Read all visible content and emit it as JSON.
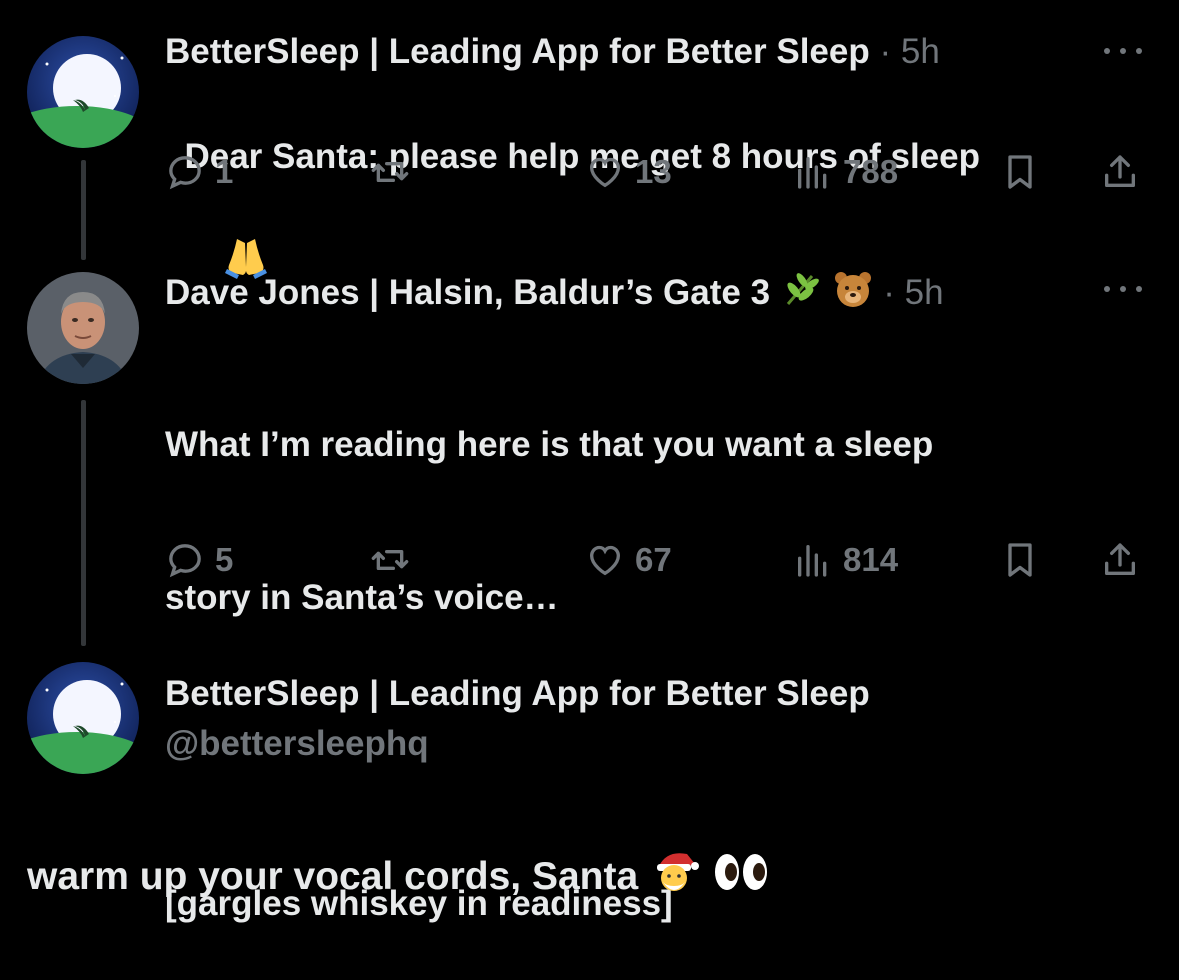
{
  "thread": {
    "tweets": [
      {
        "display_name": "BetterSleep | Leading App for Better Sleep",
        "separator": "·",
        "time": "5h",
        "text": "Dear Santa: please help me get 8 hours of sleep",
        "replies": "1",
        "likes": "13",
        "views": "788"
      },
      {
        "display_name": "Dave Jones | Halsin, Baldur’s Gate 3",
        "separator": "·",
        "time": "5h",
        "text_lines": [
          "What I’m reading here is that you want a sleep",
          "story in Santa’s voice…",
          "",
          "[gargles whiskey in readiness]"
        ],
        "replies": "5",
        "likes": "67",
        "views": "814"
      }
    ],
    "focused": {
      "display_name": "BetterSleep | Leading App for Better Sleep",
      "handle": "@bettersleephq",
      "text": "warm up your vocal cords, Santa"
    }
  },
  "icons": [
    "reply-icon",
    "retweet-icon",
    "like-icon",
    "views-icon",
    "bookmark-icon",
    "share-icon",
    "more-icon"
  ],
  "colors": {
    "background": "#000000",
    "text": "#e7e9ea",
    "muted": "#71767b",
    "thread_line": "#333639"
  }
}
